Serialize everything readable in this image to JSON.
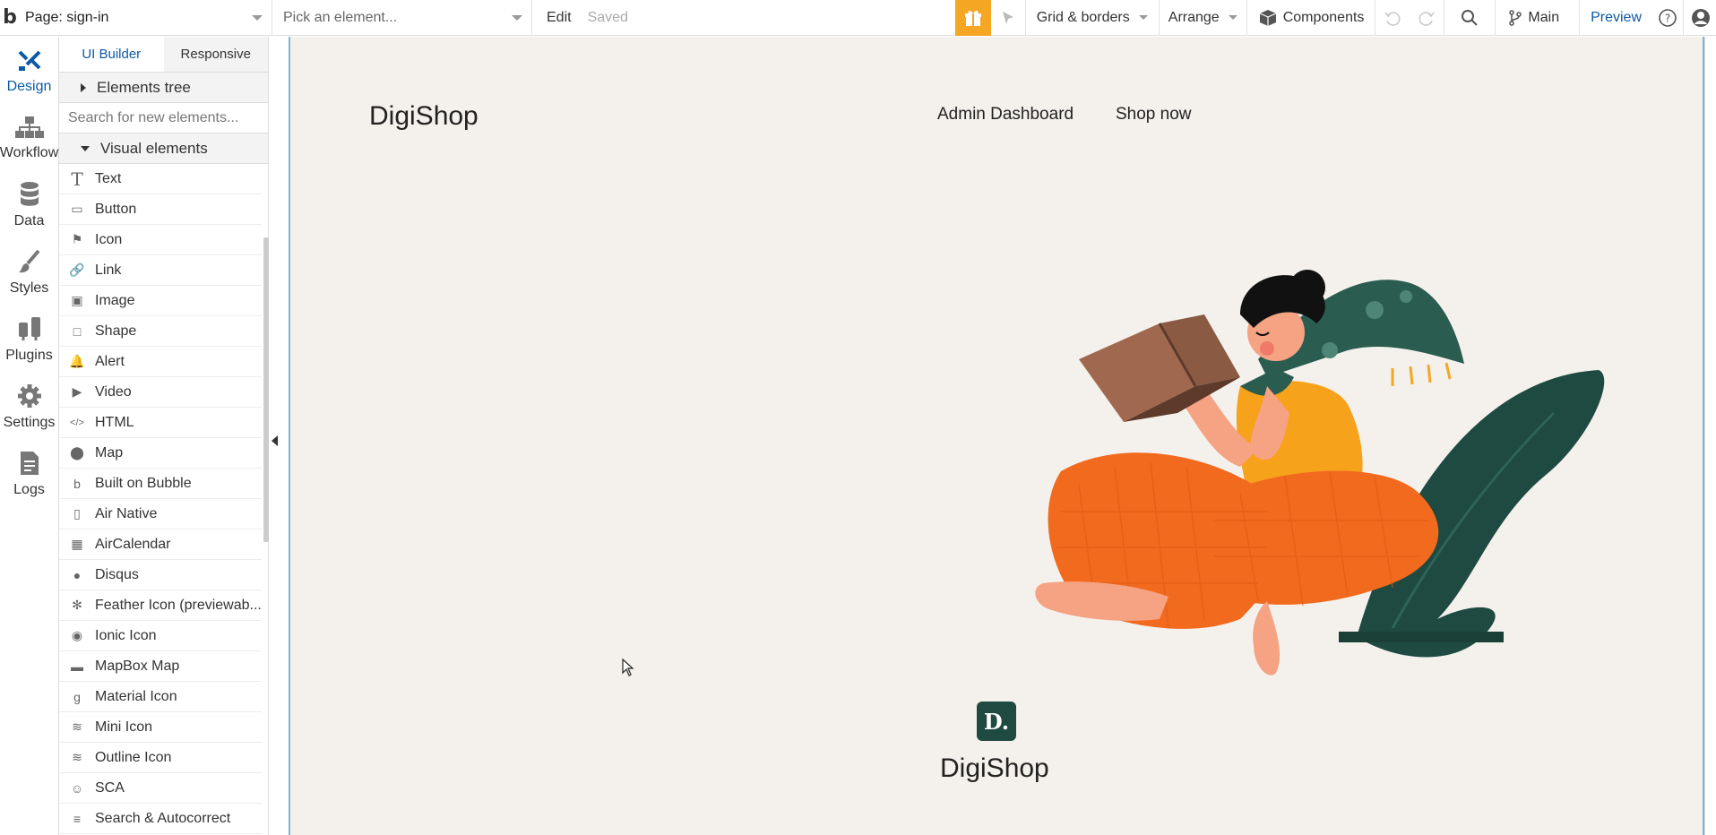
{
  "topbar": {
    "logo": "b",
    "page_selector": "Page: sign-in",
    "element_picker": "Pick an element...",
    "edit": "Edit",
    "saved": "Saved",
    "grid": "Grid & borders",
    "arrange": "Arrange",
    "components": "Components",
    "branch": "Main",
    "preview": "Preview"
  },
  "rail": {
    "items": [
      {
        "label": "Design",
        "icon": "design-icon"
      },
      {
        "label": "Workflow",
        "icon": "workflow-icon"
      },
      {
        "label": "Data",
        "icon": "database-icon"
      },
      {
        "label": "Styles",
        "icon": "brush-icon"
      },
      {
        "label": "Plugins",
        "icon": "plug-icon"
      },
      {
        "label": "Settings",
        "icon": "gear-icon"
      },
      {
        "label": "Logs",
        "icon": "document-icon"
      }
    ]
  },
  "panel": {
    "tabs": [
      "UI Builder",
      "Responsive"
    ],
    "elements_tree": "Elements tree",
    "search_placeholder": "Search for new elements...",
    "visual_elements": "Visual elements",
    "items": [
      {
        "label": "Text",
        "icon": "text-icon"
      },
      {
        "label": "Button",
        "icon": "button-icon"
      },
      {
        "label": "Icon",
        "icon": "flag-icon"
      },
      {
        "label": "Link",
        "icon": "link-icon"
      },
      {
        "label": "Image",
        "icon": "image-icon"
      },
      {
        "label": "Shape",
        "icon": "shape-icon"
      },
      {
        "label": "Alert",
        "icon": "bell-icon"
      },
      {
        "label": "Video",
        "icon": "video-icon"
      },
      {
        "label": "HTML",
        "icon": "code-icon"
      },
      {
        "label": "Map",
        "icon": "map-pin-icon"
      },
      {
        "label": "Built on Bubble",
        "icon": "bubble-icon"
      },
      {
        "label": "Air Native",
        "icon": "phone-icon"
      },
      {
        "label": "AirCalendar",
        "icon": "calendar-icon"
      },
      {
        "label": "Disqus",
        "icon": "chat-icon"
      },
      {
        "label": "Feather Icon (previewab...",
        "icon": "feather-icon"
      },
      {
        "label": "Ionic Icon",
        "icon": "ionic-icon"
      },
      {
        "label": "MapBox Map",
        "icon": "car-icon"
      },
      {
        "label": "Material Icon",
        "icon": "material-icon"
      },
      {
        "label": "Mini Icon",
        "icon": "mini-icon"
      },
      {
        "label": "Outline Icon",
        "icon": "outline-icon"
      },
      {
        "label": "SCA",
        "icon": "smiley-icon"
      },
      {
        "label": "Search & Autocorrect",
        "icon": "list-icon"
      }
    ]
  },
  "canvas": {
    "brand": "DigiShop",
    "nav": [
      "Admin Dashboard",
      "Shop now"
    ],
    "badge_letter": "D.",
    "footer_brand": "DigiShop"
  },
  "colors": {
    "accent": "#0c5aa6",
    "gift": "#f5a623",
    "canvas_bg": "#f4f1ed",
    "badge": "#1f4a41"
  }
}
